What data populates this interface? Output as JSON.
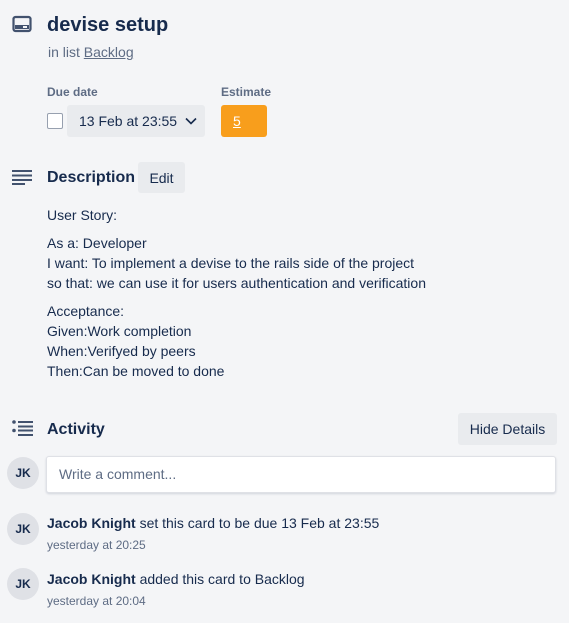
{
  "card": {
    "title": "devise setup",
    "in_list_prefix": "in list",
    "list_name": "Backlog"
  },
  "dates": {
    "due_label": "Due date",
    "due_value": "13 Feb at 23:55",
    "due_completed": false,
    "estimate_label": "Estimate",
    "estimate_value": "5",
    "estimate_color": "#f89e1c"
  },
  "description": {
    "title": "Description",
    "edit_label": "Edit",
    "lines": {
      "story": "User Story:",
      "as": "As a: Developer",
      "want": "I want: To implement a devise to the rails side of the project",
      "so": "so that: we can use it for users authentication and verification",
      "acceptance": "Acceptance:",
      "given": "Given:Work completion",
      "when": "When:Verifyed by peers",
      "then": "Then:Can be moved to done"
    }
  },
  "activity": {
    "title": "Activity",
    "hide_details_label": "Hide Details",
    "comment_placeholder": "Write a comment...",
    "current_user_initials": "JK",
    "entries": [
      {
        "initials": "JK",
        "user": "Jacob Knight",
        "action": "set this card to be due 13 Feb at 23:55",
        "time": "yesterday at 20:25"
      },
      {
        "initials": "JK",
        "user": "Jacob Knight",
        "action": "added this card to Backlog",
        "time": "yesterday at 20:04"
      }
    ]
  },
  "icons": {
    "card": "card-icon",
    "description": "description-icon",
    "activity": "activity-icon",
    "chevron": "chevron-down-icon"
  }
}
